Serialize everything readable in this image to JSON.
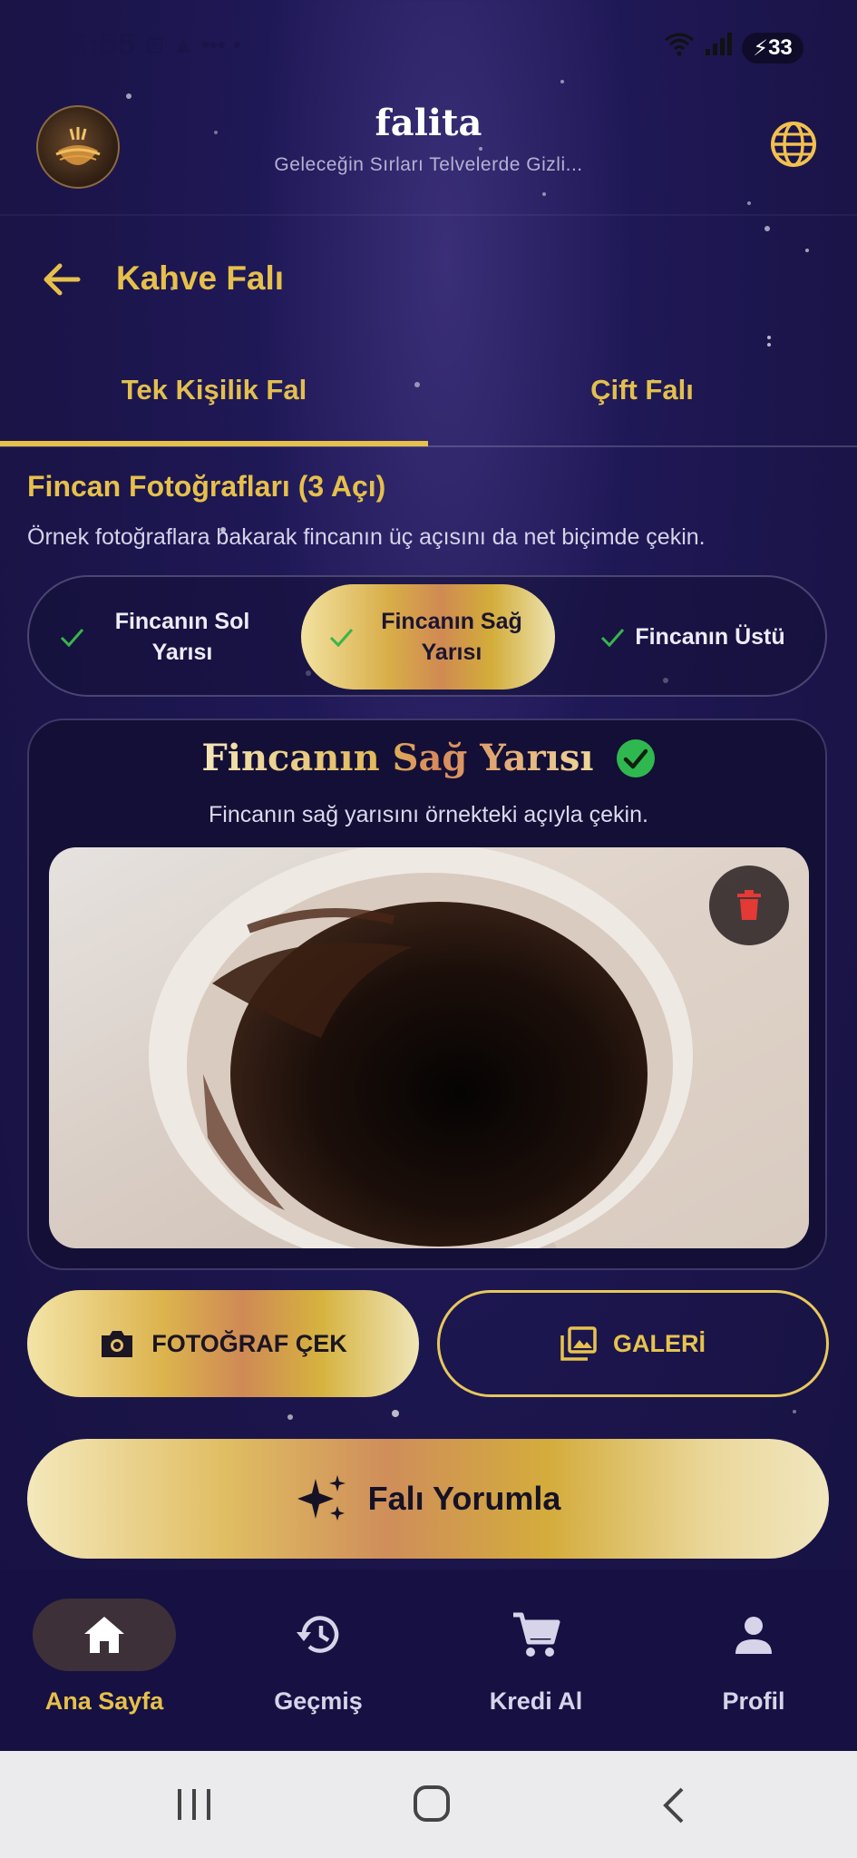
{
  "status_bar": {
    "time": "16:55",
    "battery": "33",
    "icons": "⊡ ▲ ••• •"
  },
  "header": {
    "app_name": "falita",
    "tagline": "Geleceğin Sırları Telvelerde Gizli..."
  },
  "page": {
    "title": "Kahve Falı"
  },
  "tabs": [
    {
      "label": "Tek Kişilik Fal",
      "active": true
    },
    {
      "label": "Çift Falı",
      "active": false
    }
  ],
  "section": {
    "title": "Fincan Fotoğrafları (3 Açı)",
    "description": "Örnek fotoğraflara bakarak fincanın üç açısını da net biçimde çekin."
  },
  "angles": [
    {
      "label": "Fincanın Sol Yarısı",
      "done": true,
      "selected": false
    },
    {
      "label": "Fincanın Sağ Yarısı",
      "done": true,
      "selected": true
    },
    {
      "label": "Fincanın Üstü",
      "done": true,
      "selected": false
    }
  ],
  "card": {
    "title": "Fincanın Sağ Yarısı",
    "description": "Fincanın sağ yarısını örnekteki açıyla çekin.",
    "status_icon": "check-circle-icon"
  },
  "buttons": {
    "camera": "FOTOĞRAF ÇEK",
    "gallery": "GALERİ",
    "interpret": "Falı Yorumla"
  },
  "bottom_nav": [
    {
      "label": "Ana Sayfa",
      "icon": "home-icon",
      "active": true
    },
    {
      "label": "Geçmiş",
      "icon": "history-icon",
      "active": false
    },
    {
      "label": "Kredi Al",
      "icon": "cart-icon",
      "active": false
    },
    {
      "label": "Profil",
      "icon": "person-icon",
      "active": false
    }
  ],
  "colors": {
    "gold": "#e6c04a",
    "background": "#1a1448",
    "success": "#2fb84f",
    "danger": "#e53935"
  }
}
